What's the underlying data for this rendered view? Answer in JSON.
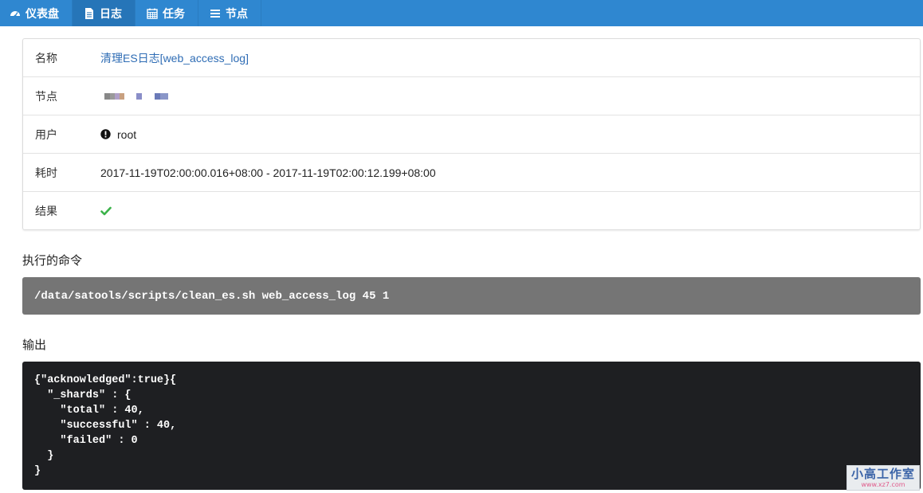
{
  "nav": {
    "items": [
      {
        "label": "仪表盘",
        "icon": "dashboard-icon",
        "active": false
      },
      {
        "label": "日志",
        "icon": "file-icon",
        "active": true
      },
      {
        "label": "任务",
        "icon": "calendar-icon",
        "active": false
      },
      {
        "label": "节点",
        "icon": "server-icon",
        "active": false
      }
    ]
  },
  "info": {
    "name_label": "名称",
    "name_value": "清理ES日志[web_access_log]",
    "node_label": "节点",
    "node_colors": [
      "#888888",
      "#9a9a9a",
      "#b0a0c8",
      "#c8a080",
      "#8a8ec8",
      "#6a7ab8",
      "#8a96c8"
    ],
    "user_label": "用户",
    "user_value": "root",
    "user_icon": "exclamation-circle-icon",
    "duration_label": "耗时",
    "duration_value": "2017-11-19T02:00:00.016+08:00 - 2017-11-19T02:00:12.199+08:00",
    "result_label": "结果",
    "result_icon": "check-icon",
    "result_color": "#3cb34a"
  },
  "command": {
    "title": "执行的命令",
    "text": "/data/satools/scripts/clean_es.sh web_access_log 45 1"
  },
  "output": {
    "title": "输出",
    "text": "{\"acknowledged\":true}{\n  \"_shards\" : {\n    \"total\" : 40,\n    \"successful\" : 40,\n    \"failed\" : 0\n  }\n}"
  },
  "watermark": {
    "main": "小高工作室",
    "sub": "www.xz7.com"
  },
  "colors": {
    "nav_bg": "#2f87d0",
    "nav_active": "#2675b8",
    "link": "#2f6db5",
    "cmd_bg": "#757575",
    "output_bg": "#1e1f22"
  }
}
